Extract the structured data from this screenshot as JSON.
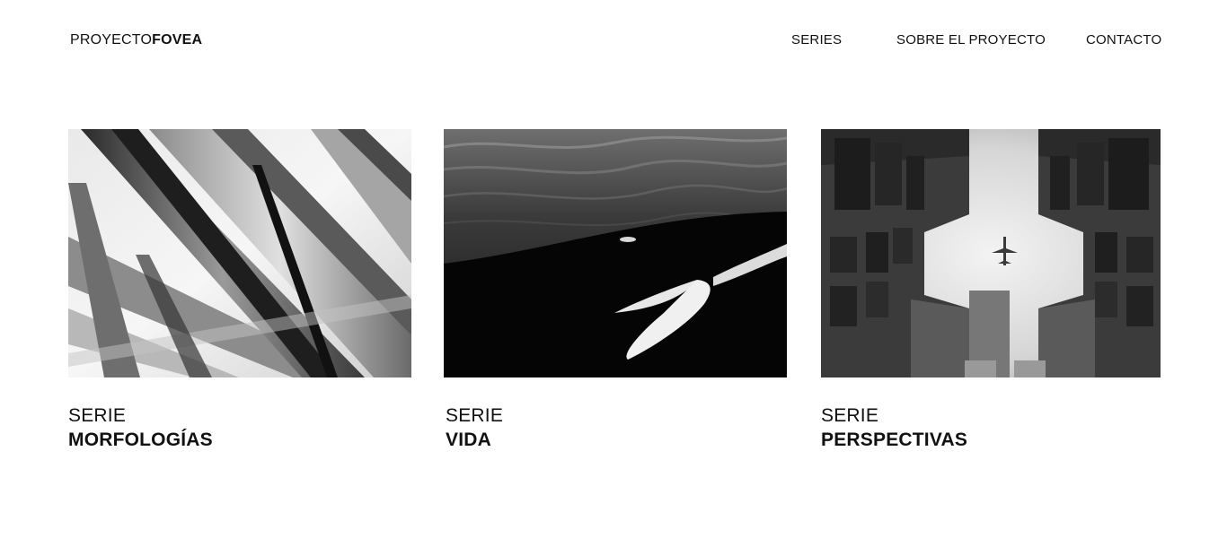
{
  "header": {
    "logo_light": "PROYECTO",
    "logo_bold": "FOVEA",
    "nav": [
      {
        "label": "SERIES"
      },
      {
        "label": "SOBRE EL PROYECTO"
      },
      {
        "label": "CONTACTO"
      }
    ]
  },
  "series": [
    {
      "kicker": "SERIE",
      "name": "MORFOLOGÍAS",
      "image": "grass-blades-photo"
    },
    {
      "kicker": "SERIE",
      "name": "VIDA",
      "image": "orca-in-water-photo"
    },
    {
      "kicker": "SERIE",
      "name": "PERSPECTIVAS",
      "image": "airplane-between-buildings-photo"
    }
  ]
}
